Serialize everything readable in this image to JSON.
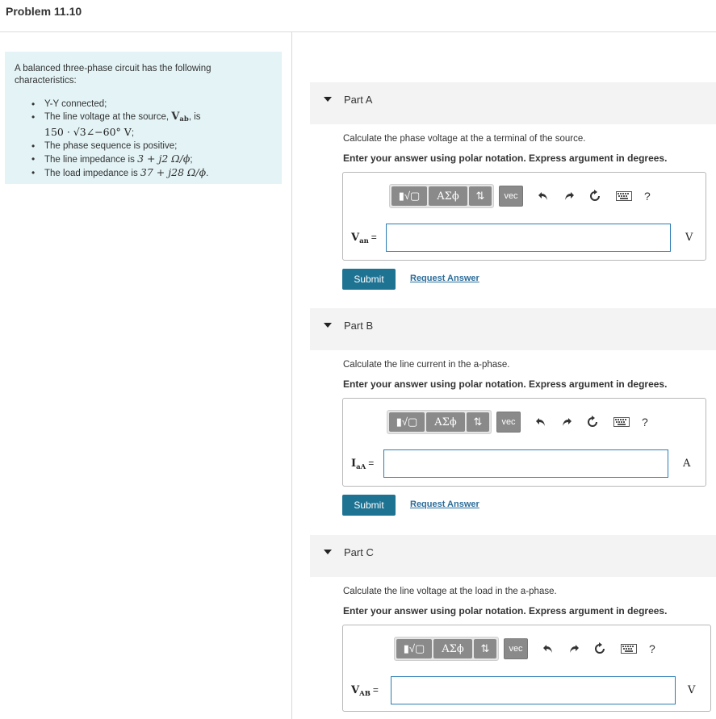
{
  "problem": {
    "title": "Problem 11.10"
  },
  "intro": {
    "text": "A balanced three-phase circuit has the following characteristics:",
    "items": [
      {
        "plain": "Y-Y connected;"
      },
      {
        "prefix": "The line voltage at the source,",
        "var": "V",
        "var_sub": "ab",
        "mid": ", is",
        "line2": "150 · √3∠−60° V",
        "end": ";"
      },
      {
        "plain": "The phase sequence is positive;"
      },
      {
        "prefix": "The line impedance is",
        "math": "3 + j2 Ω/ϕ",
        "end": ";"
      },
      {
        "prefix": "The load impedance is",
        "math": "37 + j28 Ω/ϕ",
        "end": "."
      }
    ]
  },
  "toolbar": {
    "template_glyph": "▮√▢",
    "greek_label": "ΑΣϕ",
    "arrows_label": "⇅",
    "vec_label": "vec",
    "undo_icon": "undo-icon",
    "redo_icon": "redo-icon",
    "reset_icon": "reset-icon",
    "keyboard_icon": "keyboard-icon",
    "help_label": "?"
  },
  "parts": [
    {
      "label": "Part A",
      "question": "Calculate the phase voltage at the a terminal of the source.",
      "instruction": "Enter your answer using polar notation. Express argument in degrees.",
      "var": "V",
      "var_sub": "an",
      "eq": "=",
      "value": "",
      "unit": "V",
      "submit": "Submit",
      "request": "Request Answer"
    },
    {
      "label": "Part B",
      "question": "Calculate the line current in the a-phase.",
      "instruction": "Enter your answer using polar notation. Express argument in degrees.",
      "var": "I",
      "var_sub": "aA",
      "eq": "=",
      "value": "",
      "unit": "A",
      "submit": "Submit",
      "request": "Request Answer"
    },
    {
      "label": "Part C",
      "question": "Calculate the line voltage at the load in the a-phase.",
      "instruction": "Enter your answer using polar notation. Express argument in degrees.",
      "var": "V",
      "var_sub": "AB",
      "eq": "=",
      "value": "",
      "unit": "V"
    }
  ]
}
